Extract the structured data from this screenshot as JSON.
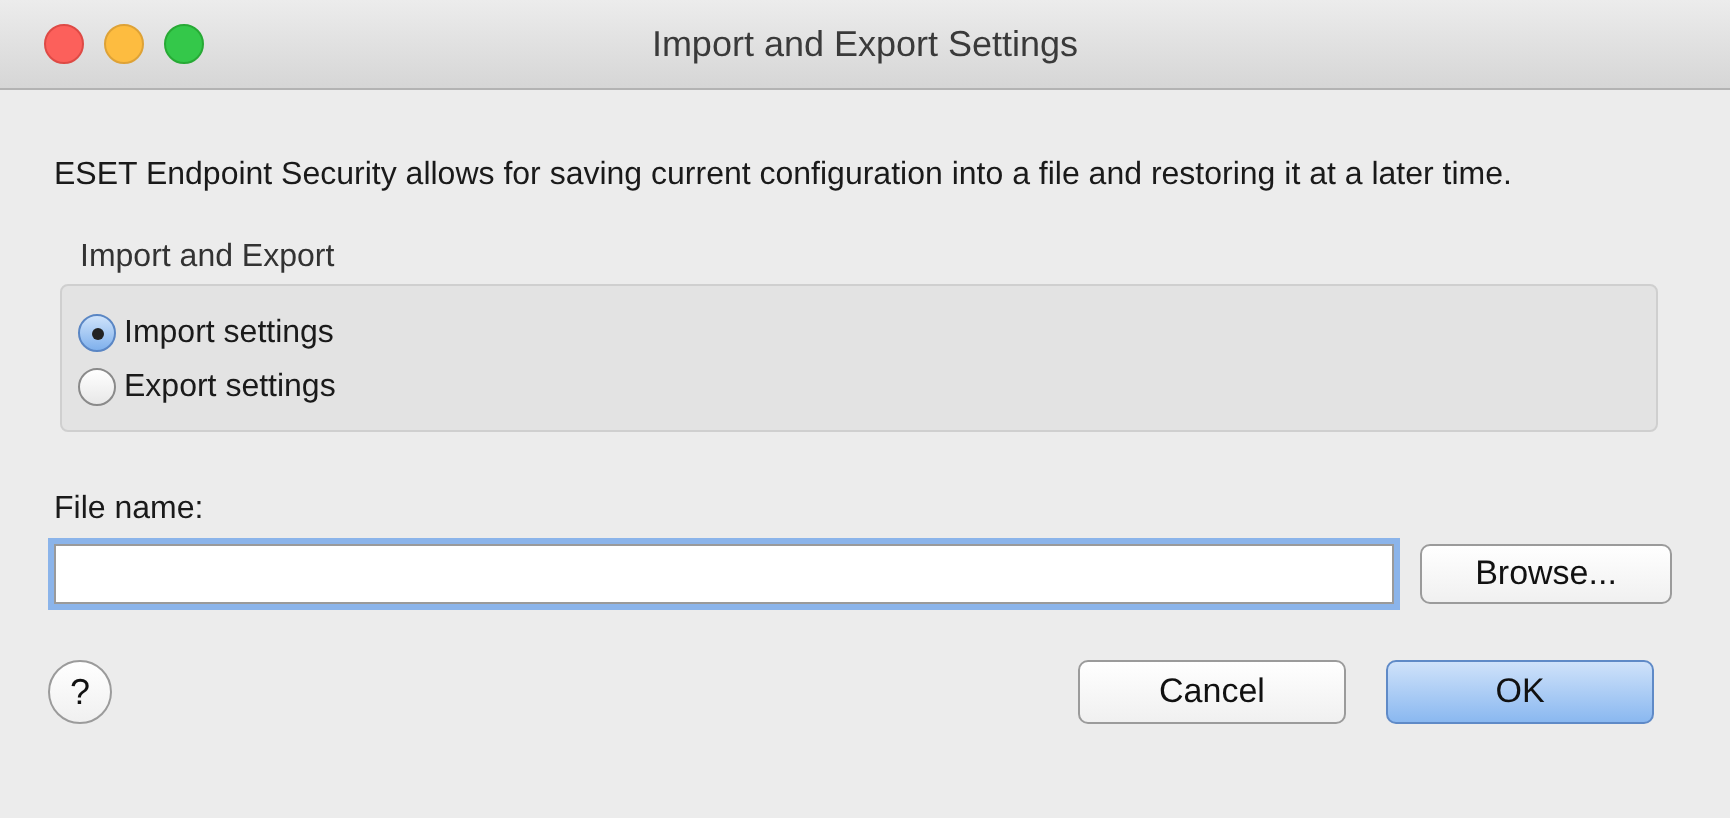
{
  "window": {
    "title": "Import and Export Settings"
  },
  "description": "ESET Endpoint Security allows for saving current configuration into a file and restoring it at a later time.",
  "group": {
    "label": "Import and Export",
    "options": [
      {
        "label": "Import settings",
        "selected": true
      },
      {
        "label": "Export settings",
        "selected": false
      }
    ]
  },
  "file_name": {
    "label": "File name:",
    "focused": true,
    "browse": "Browse..."
  },
  "help": "?",
  "buttons": [
    {
      "label": "Cancel",
      "default": false
    },
    {
      "label": "OK",
      "default": true
    }
  ]
}
